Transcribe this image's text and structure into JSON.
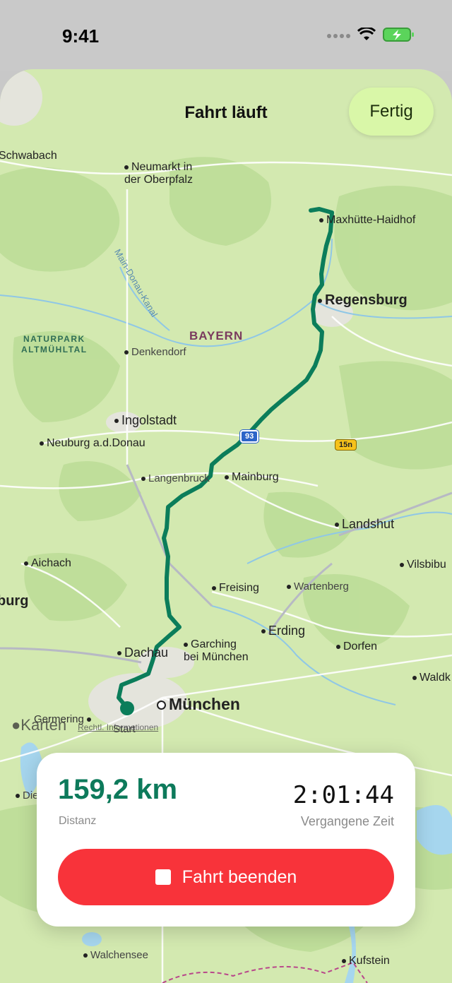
{
  "status_bar": {
    "time": "9:41"
  },
  "header": {
    "title": "Fahrt läuft",
    "done_label": "Fertig"
  },
  "map": {
    "labels": {
      "schwabach": "Schwabach",
      "neumarkt": "Neumarkt in\nder Oberpfalz",
      "maxhuette": "Maxhütte-Haidhof",
      "regensburg": "Regensburg",
      "canal": "Main-Donau-Kanal",
      "park": "NATURPARK\nALTMÜHLTAL",
      "bayern": "BAYERN",
      "denkendorf": "Denkendorf",
      "ingolstadt": "Ingolstadt",
      "neuburg": "Neuburg a.d.Donau",
      "langenbruck": "Langenbruck",
      "mainburg": "Mainburg",
      "landshut": "Landshut",
      "aichach": "Aichach",
      "vilsbiburg": "Vilsbibu",
      "burg": "burg",
      "freising": "Freising",
      "wartenberg": "Wartenberg",
      "erding": "Erding",
      "dachau": "Dachau",
      "garching": "Garching\nbei München",
      "dorfen": "Dorfen",
      "waldkraiburg": "Waldk",
      "muenchen": "München",
      "germering": "Germering",
      "start": "Start",
      "die": "Die",
      "walchensee": "Walchensee",
      "kufstein": "Kufstein"
    },
    "shields": {
      "a93": "93",
      "b15n": "15n"
    },
    "attribution": {
      "brand": "Karten",
      "legal": "Rechtl. Informationen"
    },
    "route_color": "#0b7d5a"
  },
  "ride": {
    "distance_value": "159,2 km",
    "distance_label": "Distanz",
    "elapsed_value": "2:01:44",
    "elapsed_label": "Vergangene Zeit",
    "end_label": "Fahrt beenden"
  },
  "colors": {
    "accent_green": "#0d7a5b",
    "danger_red": "#f8333a",
    "done_bg": "#d9f7a8"
  }
}
